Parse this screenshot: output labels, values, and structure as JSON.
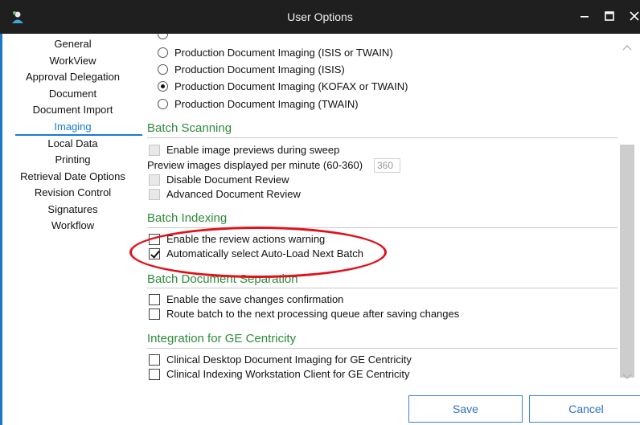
{
  "window": {
    "title": "User Options",
    "app_icon": "user-icon",
    "controls": [
      "minimize-icon",
      "maximize-icon",
      "close-icon"
    ]
  },
  "sidebar": {
    "items": [
      {
        "label": "General"
      },
      {
        "label": "WorkView"
      },
      {
        "label": "Approval Delegation"
      },
      {
        "label": "Document"
      },
      {
        "label": "Document Import"
      },
      {
        "label": "Imaging",
        "selected": true
      },
      {
        "label": "Local Data"
      },
      {
        "label": "Printing"
      },
      {
        "label": "Retrieval Date Options"
      },
      {
        "label": "Revision Control"
      },
      {
        "label": "Signatures"
      },
      {
        "label": "Workflow"
      }
    ],
    "accent_color": "#1a7ad4"
  },
  "imaging_options": {
    "items": [
      {
        "label": "Production Document Imaging (ISIS or TWAIN)",
        "selected": false
      },
      {
        "label": "Production Document Imaging (ISIS)",
        "selected": false
      },
      {
        "label": "Production Document Imaging (KOFAX or TWAIN)",
        "selected": true
      },
      {
        "label": "Production Document Imaging (TWAIN)",
        "selected": false
      }
    ]
  },
  "batch_scanning": {
    "title": "Batch Scanning",
    "enable_previews": {
      "label": "Enable image previews during sweep",
      "checked": false,
      "enabled": false
    },
    "ppm_label": "Preview images displayed per minute (60-360)",
    "ppm_value": "360",
    "disable_review": {
      "label": "Disable Document Review",
      "checked": false,
      "enabled": false
    },
    "advanced_review": {
      "label": "Advanced Document Review",
      "checked": false,
      "enabled": false
    }
  },
  "batch_indexing": {
    "title": "Batch Indexing",
    "review_warning": {
      "label": "Enable the review actions warning",
      "checked": false
    },
    "auto_load": {
      "label": "Automatically select Auto-Load Next Batch",
      "checked": true
    }
  },
  "batch_separation": {
    "title": "Batch Document Separation",
    "save_confirm": {
      "label": "Enable the save changes confirmation",
      "checked": false
    },
    "route_batch": {
      "label": "Route batch to the next processing queue after saving changes",
      "checked": false
    }
  },
  "ge_integration": {
    "title": "Integration for GE Centricity",
    "desktop": {
      "label": "Clinical Desktop Document Imaging for GE Centricity",
      "checked": false
    },
    "workstation": {
      "label": "Clinical Indexing Workstation Client for GE Centricity",
      "checked": false
    }
  },
  "footer": {
    "save_label": "Save",
    "cancel_label": "Cancel"
  },
  "colors": {
    "section_title": "#2d8a3a",
    "annotation": "#e0111b",
    "titlebar": "#1f1f1f"
  }
}
